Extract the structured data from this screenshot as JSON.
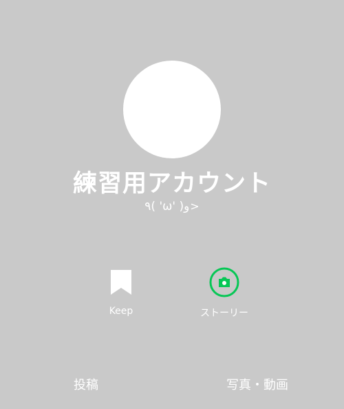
{
  "profile": {
    "name": "練習用アカウント",
    "status_message": "٩( 'ω' )و",
    "status_arrow": ">"
  },
  "actions": [
    {
      "label": "Keep",
      "icon": "bookmark-icon"
    },
    {
      "label": "ストーリー",
      "icon": "camera-icon",
      "accent": "#06c755"
    }
  ],
  "tabs": [
    {
      "label": "投稿"
    },
    {
      "label": "写真・動画"
    }
  ],
  "colors": {
    "background": "#c9c9c9",
    "text": "#ffffff",
    "story_accent": "#06c755"
  }
}
